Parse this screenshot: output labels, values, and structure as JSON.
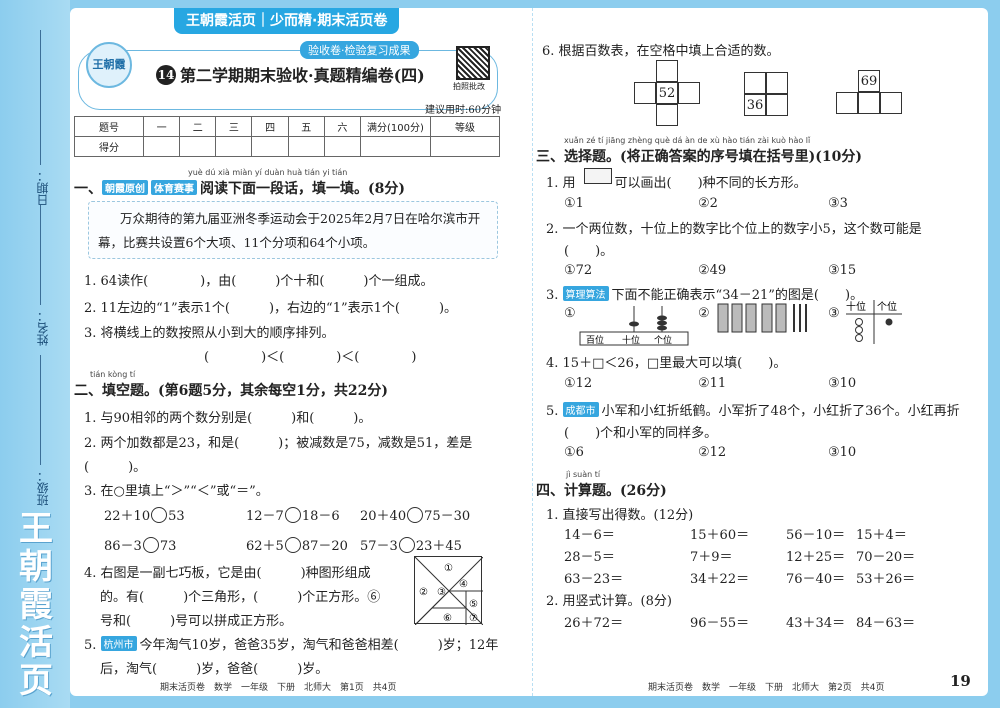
{
  "sidebar": {
    "date_label": "日期：",
    "name_label": "姓名：",
    "class_label": "班级：",
    "logo": "王朝霞活页"
  },
  "header": {
    "banner": "王朝霞活页｜少而精·期末活页卷",
    "sub_banner": "验收卷·检验复习成果",
    "badge": "王朝霞",
    "number": "14",
    "title": "第二学期期末验收·真题精编卷(四)",
    "qr_label": "拍照批改",
    "time_note": "建议用时:60分钟"
  },
  "score_table": {
    "row1": [
      "题号",
      "一",
      "二",
      "三",
      "四",
      "五",
      "六",
      "满分(100分)",
      "等级"
    ],
    "row2_label": "得分"
  },
  "sec1": {
    "pinyin": "yuè dú xià miàn yí duàn huà   tián yi tián",
    "tags": [
      "朝霞原创",
      "体育赛事"
    ],
    "heading": "阅读下面一段话，填一填。(8分)",
    "passage_l1": "万众期待的第九届亚洲冬季运动会于2025年2月7日在哈尔滨市开",
    "passage_l2": "幕，比赛共设置6个大项、11个分项和64个小项。",
    "q1": "1. 64读作(　　　　)，由(　　　)个十和(　　　)个一组成。",
    "q2": "2. 11左边的“1”表示1个(　　　)，右边的“1”表示1个(　　　)。",
    "q3": "3. 将横线上的数按照从小到大的顺序排列。",
    "q3_blank": "(　　　　)＜(　　　　)＜(　　　　)"
  },
  "sec2": {
    "pinyin": "tián kòng tí",
    "heading": "二、填空题。(第6题5分，其余每空1分，共22分)",
    "q1": "1. 与90相邻的两个数分别是(　　　)和(　　　)。",
    "q2": "2. 两个加数都是23，和是(　　　)；被减数是75，减数是51，差是",
    "q2b": "(　　　)。",
    "q3": "3. 在○里填上“＞”“＜”或“＝”。",
    "cmp": [
      [
        "22＋10",
        "53"
      ],
      [
        "12－7",
        "18－6"
      ],
      [
        "20＋40",
        "75－30"
      ],
      [
        "86－3",
        "73"
      ],
      [
        "62＋5",
        "87－20"
      ],
      [
        "57－3",
        "23＋45"
      ]
    ],
    "q4_l1": "4. 右图是一副七巧板，它是由(　　　)种图形组成",
    "q4_l2": "的。有(　　　)个三角形，(　　　)个正方形。⑥",
    "q4_l3": "号和(　　　)号可以拼成正方形。",
    "tangram_labels": [
      "①",
      "②",
      "③",
      "④",
      "⑤",
      "⑥",
      "⑦"
    ],
    "q5_tag": "杭州市",
    "q5_l1": "今年淘气10岁，爸爸35岁，淘气和爸爸相差(　　　)岁；12年",
    "q5_l2": "后，淘气(　　　)岁，爸爸(　　　)岁。"
  },
  "sec2_q6": {
    "text": "6. 根据百数表，在空格中填上合适的数。",
    "n1": "52",
    "n2": "36",
    "n3": "69"
  },
  "sec3": {
    "pinyin": "xuǎn zé tí    jiāng zhèng què dá àn de xù hào tián zài kuò hào lǐ",
    "heading": "三、选择题。(将正确答案的序号填在括号里)(10分)",
    "q1": "1. 用　　　可以画出(　　)种不同的长方形。",
    "q1_opts": [
      "①1",
      "②2",
      "③3"
    ],
    "q2": "2. 一个两位数，十位上的数字比个位上的数字小5，这个数可能是",
    "q2b": "(　　)。",
    "q2_opts": [
      "①72",
      "②49",
      "③15"
    ],
    "q3_tag": "算理算法",
    "q3": "下面不能正确表示“34－21”的图是(　　)。",
    "q3_labels": [
      "①",
      "②",
      "③"
    ],
    "abacus_labels": [
      "百位",
      "十位",
      "个位"
    ],
    "place_labels": [
      "十位",
      "个位"
    ],
    "q4": "4. 15＋□＜26，□里最大可以填(　　)。",
    "q4_opts": [
      "①12",
      "②11",
      "③10"
    ],
    "q5_tag": "成都市",
    "q5_l1": "小军和小红折纸鹤。小军折了48个，小红折了36个。小红再折",
    "q5_l2": "(　　)个和小军的同样多。",
    "q5_opts": [
      "①6",
      "②12",
      "③10"
    ]
  },
  "sec4": {
    "pinyin": "jì suàn tí",
    "heading": "四、计算题。(26分)",
    "q1": "1. 直接写出得数。(12分)",
    "direct": [
      [
        "14－6＝",
        "15＋60＝",
        "56－10＝",
        "15＋4＝"
      ],
      [
        "28－5＝",
        "7＋9＝",
        "12＋25＝",
        "70－20＝"
      ],
      [
        "63－23＝",
        "34＋22＝",
        "76－40＝",
        "53＋26＝"
      ]
    ],
    "q2": "2. 用竖式计算。(8分)",
    "vertical": [
      "26＋72＝",
      "96－55＝",
      "43＋34＝",
      "84－63＝"
    ]
  },
  "footer": {
    "left": "期末活页卷　数学　一年级　下册　北师大　第1页　共4页",
    "right": "期末活页卷　数学　一年级　下册　北师大　第2页　共4页",
    "page": "19"
  }
}
